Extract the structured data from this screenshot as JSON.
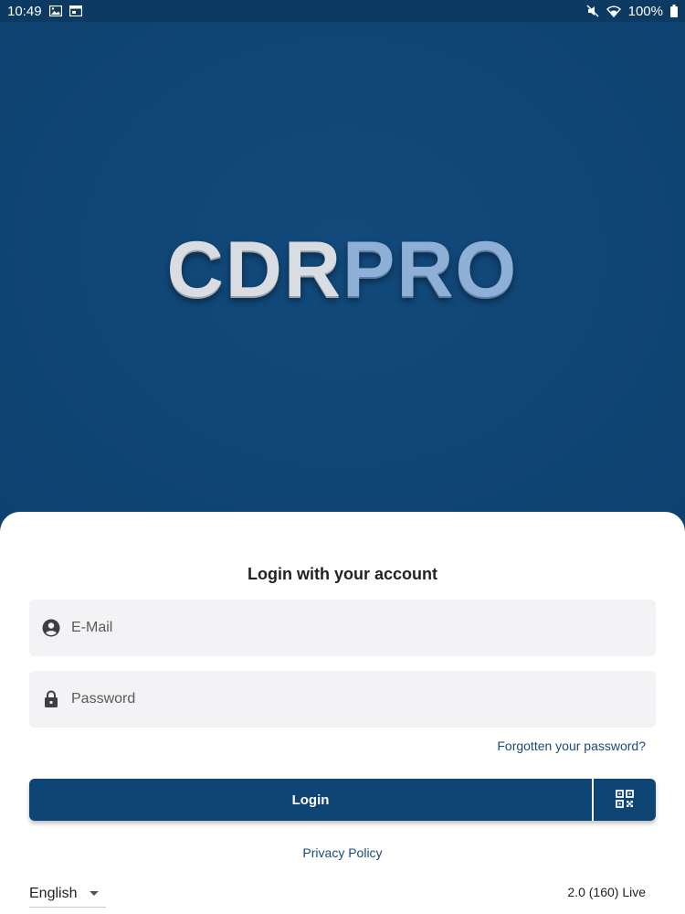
{
  "status_bar": {
    "time": "10:49",
    "battery": "100%",
    "icons": [
      "image-icon",
      "calendar-icon",
      "mute-icon",
      "wifi-icon",
      "battery-icon"
    ]
  },
  "logo": {
    "part1": "CDR",
    "part2": "PRO"
  },
  "login": {
    "title": "Login with your account",
    "email_placeholder": "E-Mail",
    "email_value": "",
    "password_placeholder": "Password",
    "password_value": "",
    "forgot_label": "Forgotten your password?",
    "login_label": "Login",
    "qr_icon": "qr-code-icon"
  },
  "footer": {
    "privacy_label": "Privacy Policy",
    "language": "English",
    "version": "2.0 (160) Live"
  },
  "colors": {
    "brand_blue": "#0f4574",
    "link": "#1c4a78",
    "field_bg": "#f3f2f4"
  }
}
